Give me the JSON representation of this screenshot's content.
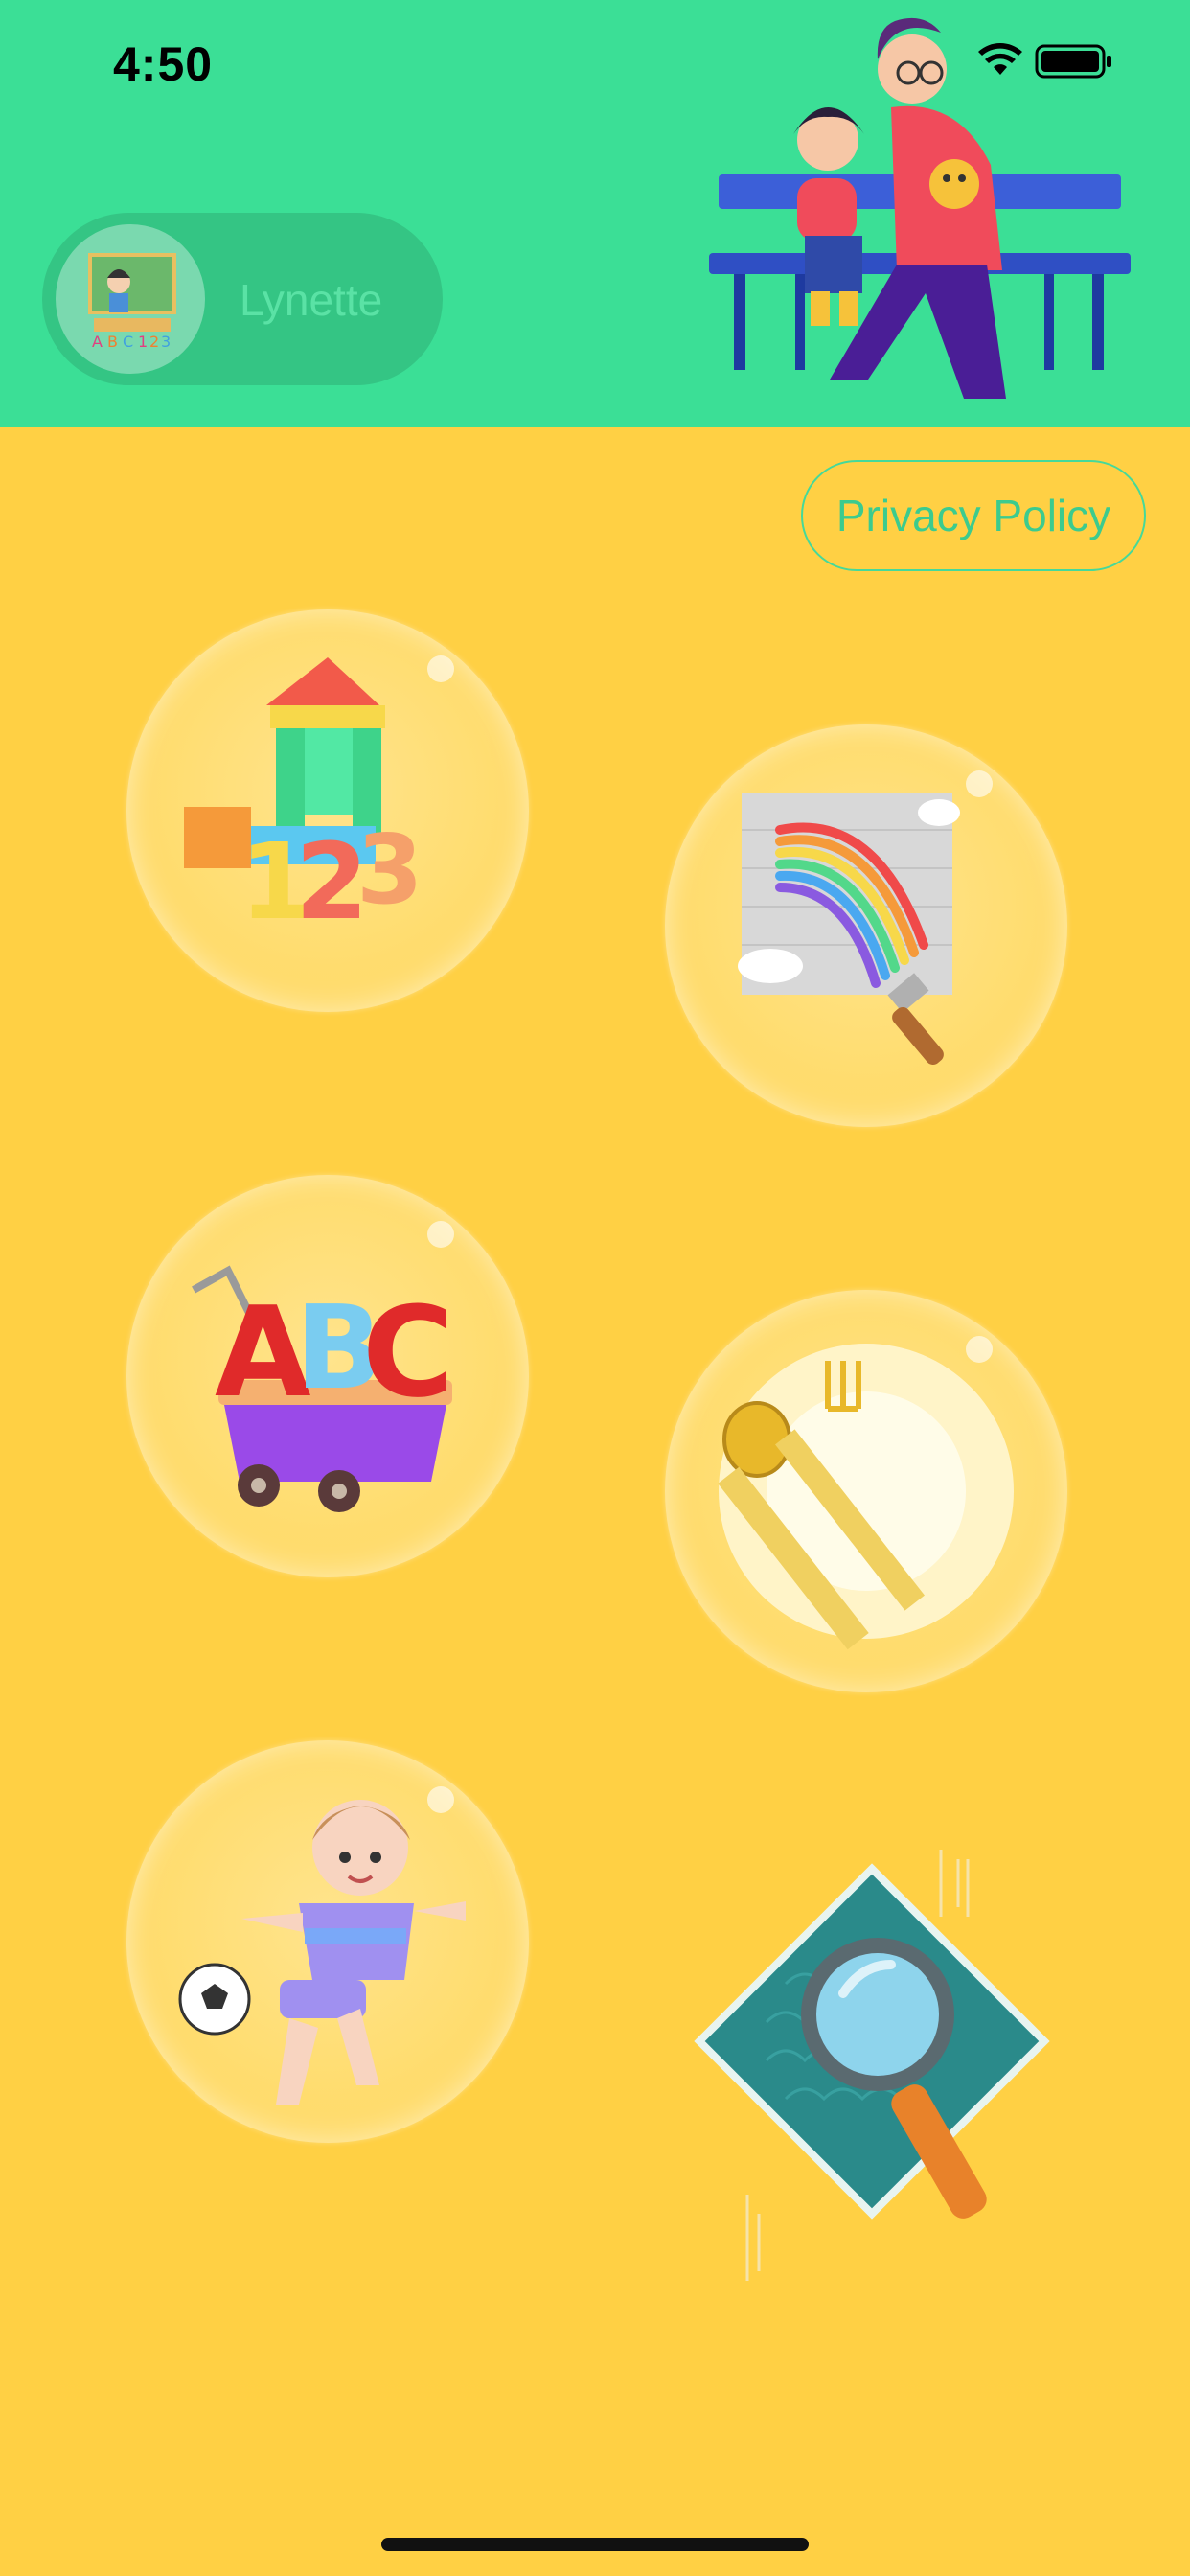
{
  "status_bar": {
    "time": "4:50"
  },
  "profile": {
    "name": "Lynette"
  },
  "header": {
    "privacy_label": "Privacy Policy"
  },
  "menu": {
    "items": [
      {
        "icon": "numbers-blocks-icon"
      },
      {
        "icon": "rainbow-paintbrush-icon"
      },
      {
        "icon": "abc-cart-icon"
      },
      {
        "icon": "spoon-fork-plate-icon"
      },
      {
        "icon": "boy-soccer-icon"
      },
      {
        "icon": "magnifying-glass-icon"
      }
    ]
  },
  "colors": {
    "header_bg": "#3BDF96",
    "page_bg": "#FFD044",
    "accent": "#3CCB8E"
  }
}
